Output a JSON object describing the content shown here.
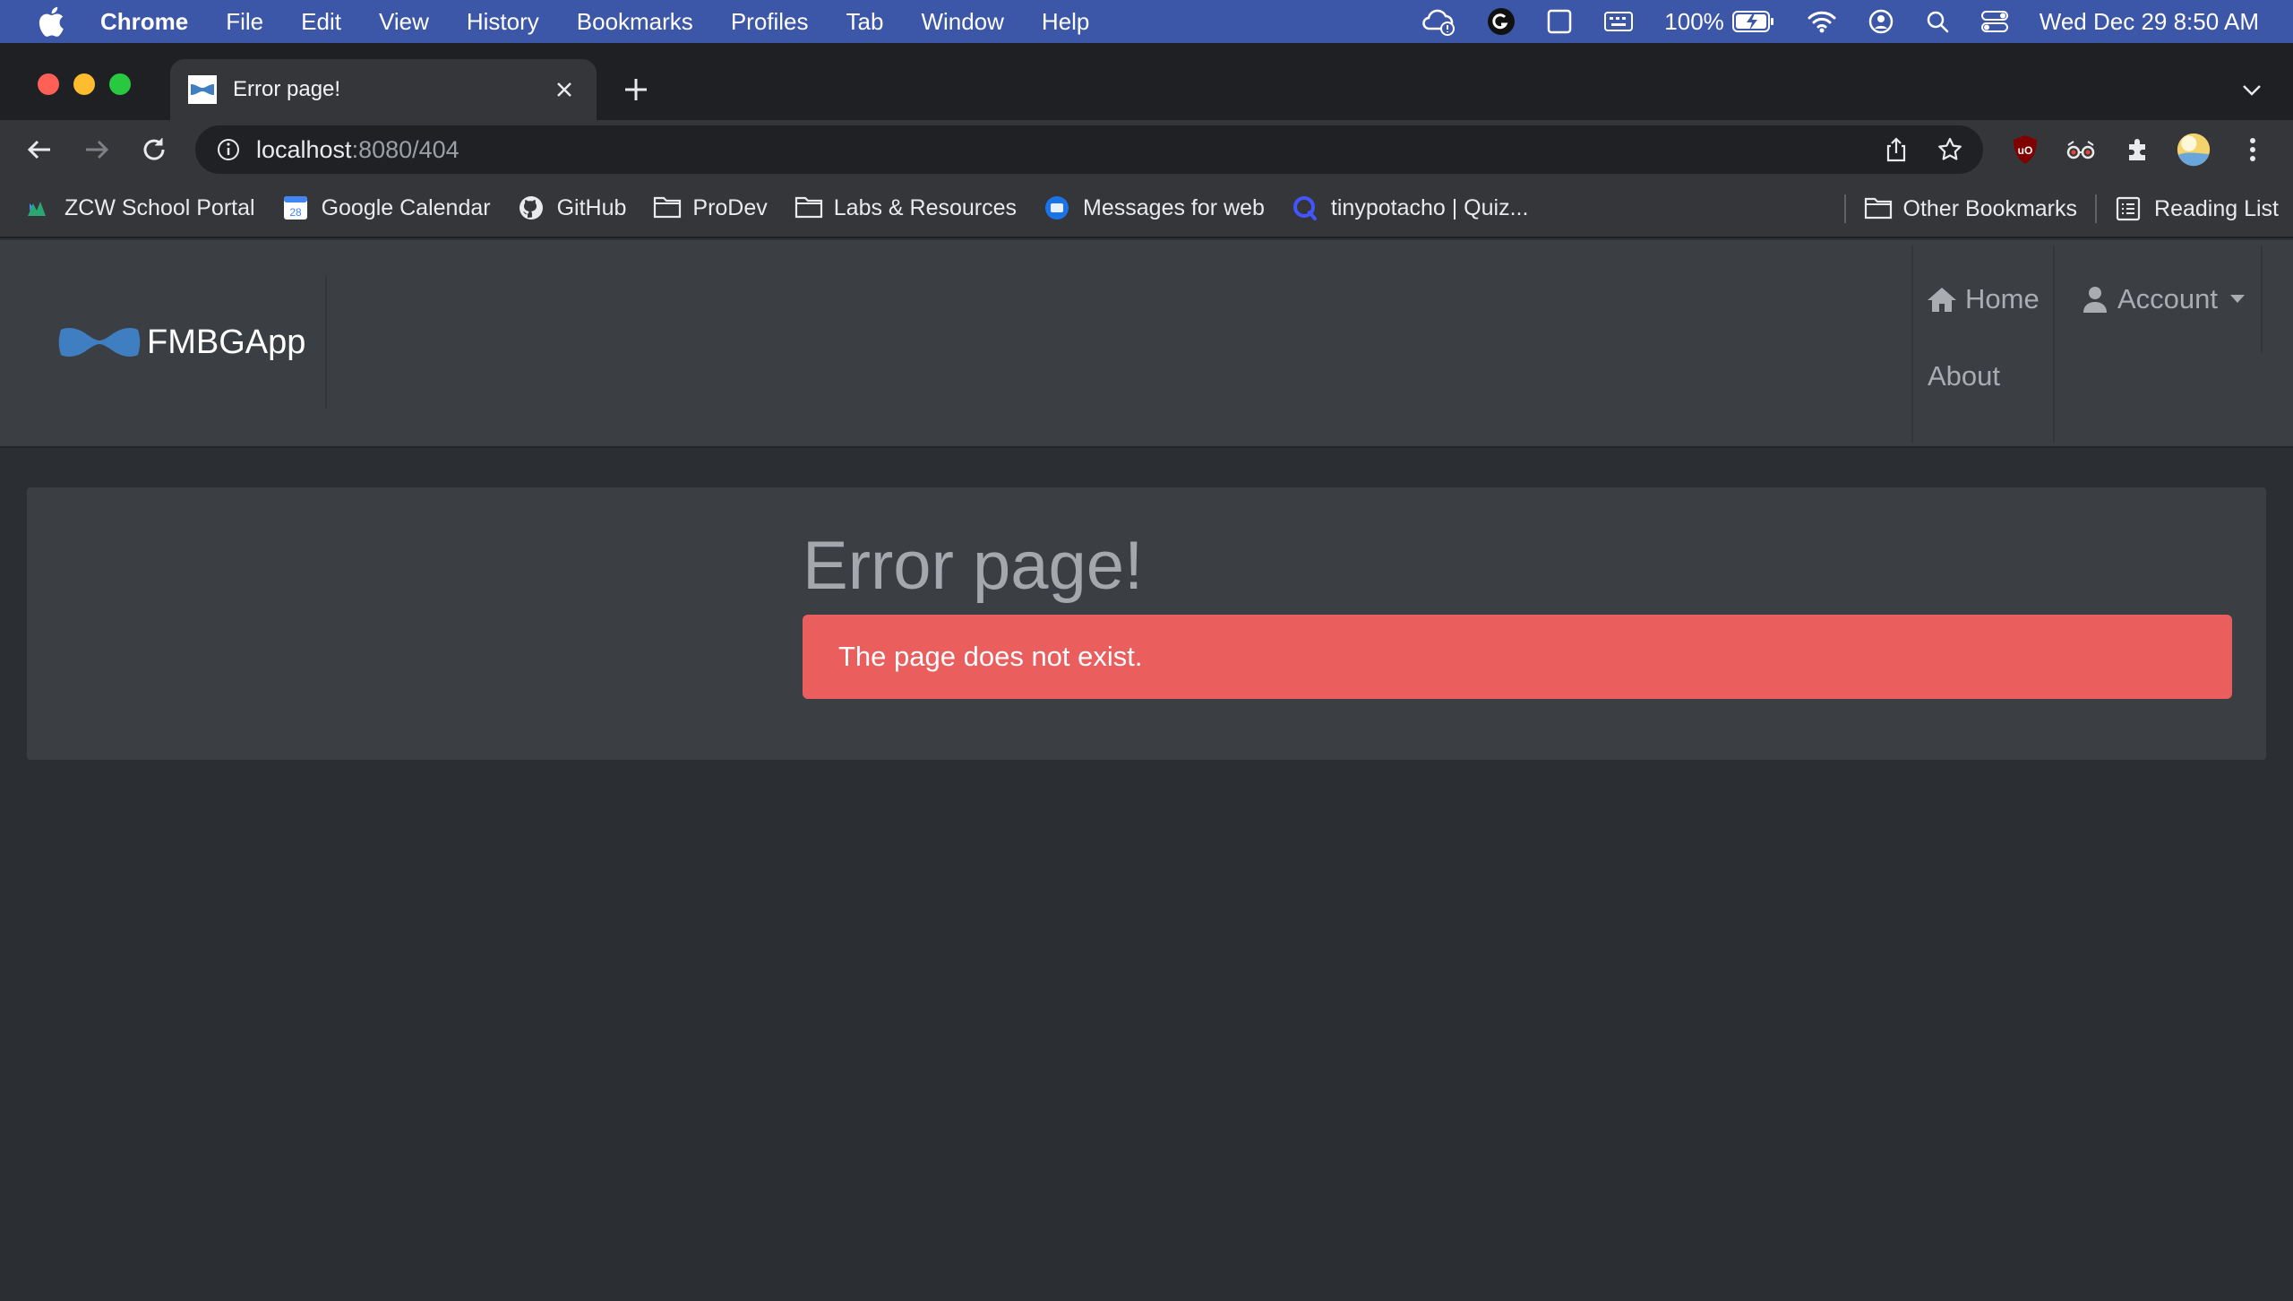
{
  "menubar": {
    "app_name": "Chrome",
    "items": [
      "File",
      "Edit",
      "View",
      "History",
      "Bookmarks",
      "Profiles",
      "Tab",
      "Window",
      "Help"
    ],
    "battery": "100%",
    "clock": "Wed Dec 29  8:50 AM"
  },
  "browser": {
    "tab_title": "Error page!",
    "url_host": "localhost",
    "url_path": ":8080/404",
    "bookmarks": [
      {
        "label": "ZCW School Portal",
        "icon": "zcw-icon"
      },
      {
        "label": "Google Calendar",
        "icon": "calendar-icon"
      },
      {
        "label": "GitHub",
        "icon": "github-icon"
      },
      {
        "label": "ProDev",
        "icon": "folder-icon"
      },
      {
        "label": "Labs & Resources",
        "icon": "folder-icon"
      },
      {
        "label": "Messages for web",
        "icon": "messages-icon"
      },
      {
        "label": "tinypotacho | Quiz...",
        "icon": "quizlet-icon"
      }
    ],
    "other_bookmarks": "Other Bookmarks",
    "reading_list": "Reading List",
    "calendar_day": "28"
  },
  "app": {
    "brand": "FMBGApp",
    "nav": {
      "home": "Home",
      "account": "Account",
      "about": "About"
    },
    "heading": "Error page!",
    "alert": "The page does not exist.",
    "colors": {
      "navbar": "#3b3f44",
      "background": "#2b2e33",
      "alert": "#ea5e5e",
      "brand_logo": "#3f7ec0"
    }
  }
}
